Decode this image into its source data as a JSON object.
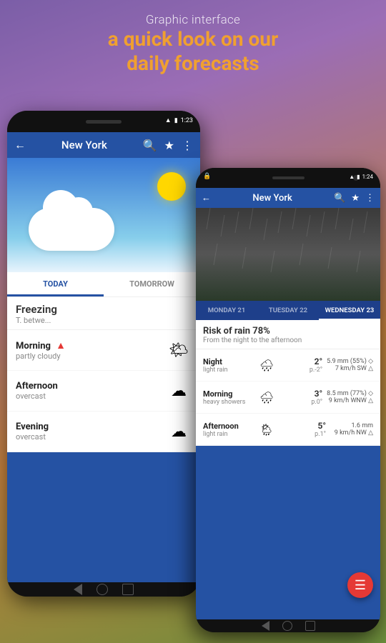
{
  "header": {
    "subtitle": "Graphic interface",
    "title_line1": "a quick look on our",
    "title_line2": "daily forecasts",
    "accent_color": "#f0a030"
  },
  "phone_left": {
    "status_time": "1:23",
    "city": "New York",
    "tabs": [
      "TODAY",
      "TOMORROW"
    ],
    "active_tab": 0,
    "freezing": {
      "main": "Freezing",
      "sub": "T. betwe..."
    },
    "rows": [
      {
        "time": "Morning",
        "alert": true,
        "condition": "partly cloudy",
        "icon": "🌤"
      },
      {
        "time": "Afternoon",
        "alert": false,
        "condition": "overcast",
        "icon": "☁"
      },
      {
        "time": "Evening",
        "alert": false,
        "condition": "overcast",
        "icon": "☁"
      }
    ]
  },
  "phone_right": {
    "status_time": "1:24",
    "city": "New York",
    "days": [
      "MONDAY 21",
      "TUESDAY 22",
      "WEDNESDAY 23"
    ],
    "active_day": 2,
    "alert": {
      "main": "Risk of rain 78%",
      "sub": "From the night to the afternoon"
    },
    "rows": [
      {
        "time": "Night",
        "condition": "light rain",
        "icon": "🌧",
        "temp": "2°",
        "temp_sub": "p.-2°",
        "precip": "5.9 mm (55%) ◇",
        "wind": "7 km/h SW △"
      },
      {
        "time": "Morning",
        "condition": "heavy showers",
        "icon": "🌧",
        "temp": "3°",
        "temp_sub": "p.0°",
        "precip": "8.5 mm (77%) ◇",
        "wind": "9 km/h WNW △"
      },
      {
        "time": "Afternoon",
        "condition": "light rain",
        "icon": "🌦",
        "temp": "5°",
        "temp_sub": "p.1°",
        "precip": "1.6 mm",
        "wind": "9 km/h NW △"
      }
    ]
  }
}
